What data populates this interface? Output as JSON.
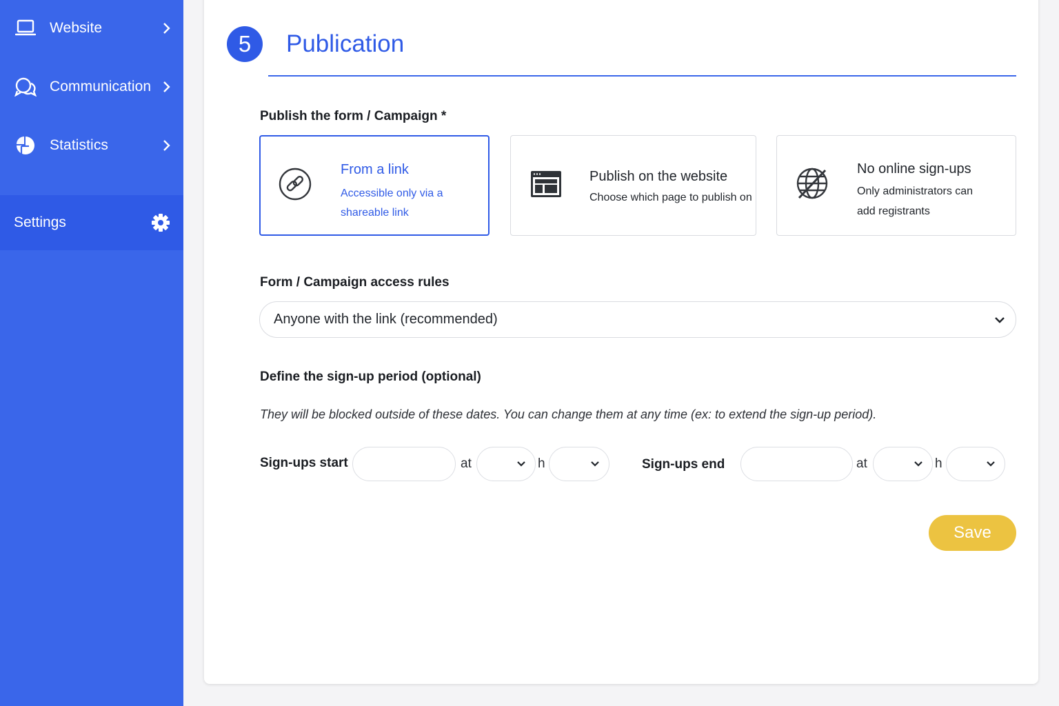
{
  "sidebar": {
    "items": [
      {
        "label": "Website",
        "icon": "laptop-icon"
      },
      {
        "label": "Communication",
        "icon": "chat-bubbles-icon"
      },
      {
        "label": "Statistics",
        "icon": "pie-chart-icon"
      }
    ],
    "settings": {
      "label": "Settings",
      "icon": "gear-icon"
    }
  },
  "section": {
    "step": "5",
    "title": "Publication"
  },
  "publish": {
    "label": "Publish the form / Campaign *",
    "options": [
      {
        "title": "From a link",
        "desc1": "Accessible only via a",
        "desc2": "shareable link",
        "icon": "link-icon",
        "selected": true
      },
      {
        "title": "Publish on the website",
        "desc1": "Choose which page to publish on",
        "icon": "browser-window-icon",
        "selected": false
      },
      {
        "title": "No online sign-ups",
        "desc1": "Only administrators can",
        "desc2": "add registrants",
        "icon": "globe-off-icon",
        "selected": false
      }
    ]
  },
  "access": {
    "label": "Form / Campaign access rules",
    "value": "Anyone with the link (recommended)"
  },
  "period": {
    "label": "Define the sign-up period (optional)",
    "hint": "They will be blocked outside of these dates. You can change them at any time (ex: to extend the sign-up period).",
    "start_label": "Sign-ups start",
    "end_label": "Sign-ups end",
    "at": "at",
    "h": "h",
    "start_date": "",
    "start_hour": "",
    "start_minute": "",
    "end_date": "",
    "end_hour": "",
    "end_minute": ""
  },
  "actions": {
    "save": "Save"
  },
  "colors": {
    "primary": "#2f5ae6",
    "sidebar": "#3a66ea",
    "save": "#ecc341"
  }
}
